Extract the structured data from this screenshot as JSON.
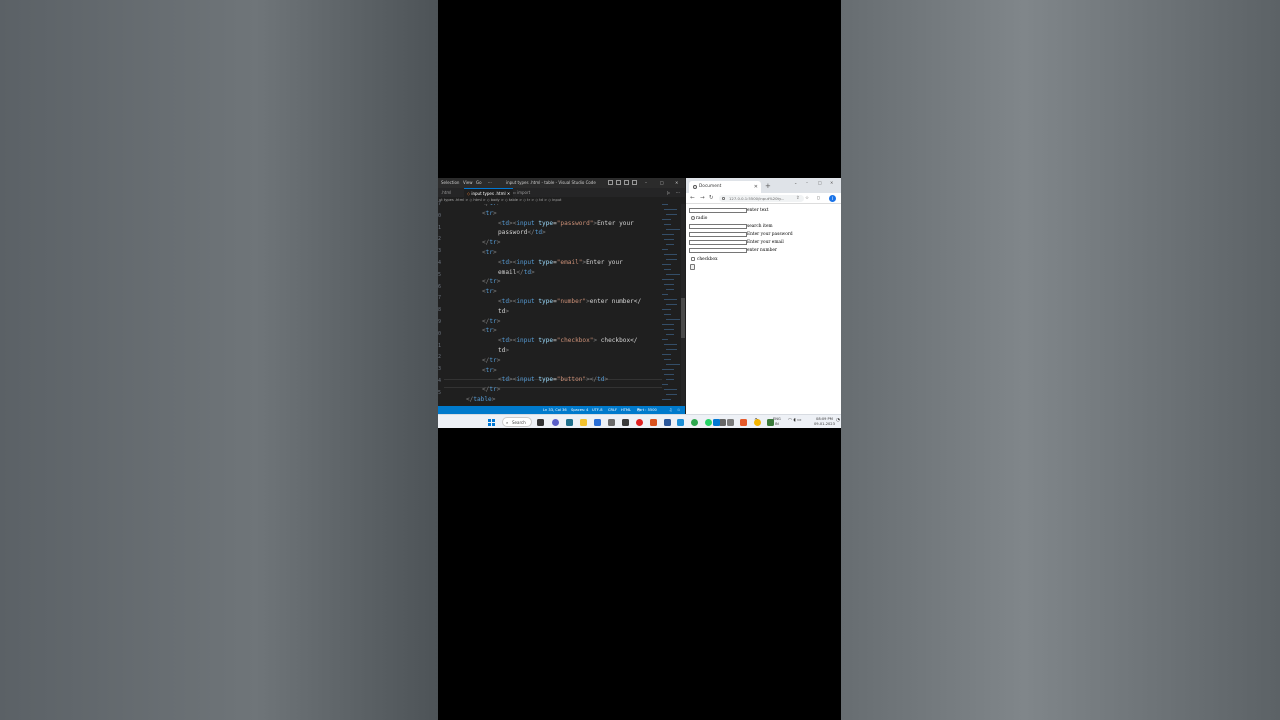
{
  "vscode": {
    "menu": [
      "Selection",
      "View",
      "Go",
      "···"
    ],
    "title": "input types .html - table - Visual Studio Code",
    "tabs": [
      ".html",
      "input types .html",
      "import"
    ],
    "breadcrumb": "ut types .html > ◇ html > ◇ body > ◇ table > ◇ tr > ◇ td > ◇ input",
    "gutter": [
      "7",
      "0",
      "1",
      "2",
      "3",
      "4",
      "5",
      "6",
      "7",
      "8",
      "9",
      "0",
      "1",
      "2",
      "3",
      "4",
      "5"
    ],
    "code_lines": [
      "</tr>",
      "<tr>",
      "<td><input type=\"password\">Enter your",
      "password</td>",
      "</tr>",
      "<tr>",
      "<td><input type=\"email\">Enter your",
      "email</td>",
      "</tr>",
      "<tr>",
      "<td><input type=\"number\">enter number</",
      "td>",
      "</tr>",
      "<tr>",
      "<td><input type=\"checkbox\"> checkbox</",
      "td>",
      "</tr>",
      "<tr>",
      "<td><input type=\"button\"></td>",
      "</tr>",
      "</table>"
    ],
    "status": {
      "position": "Ln 33, Col 36",
      "spaces": "Spaces: 4",
      "encoding": "UTF-8",
      "eol": "CRLF",
      "language": "HTML",
      "port": "Port : 5500"
    }
  },
  "browser": {
    "tab_title": "Document",
    "url": "127.0.0.1:5500/input%20ty...",
    "profile_initial": "I",
    "labels": {
      "text": "enter text",
      "radio": "radio",
      "search": "search item",
      "password": "Enter your password",
      "email": "Enter your email",
      "number": "enter number",
      "checkbox": "checkbox"
    }
  },
  "taskbar": {
    "search_label": "Search",
    "lang": "ENG",
    "lang_region": "IN",
    "time": "08:09 PM",
    "date": "09-01-2023"
  },
  "colors": {
    "vscode_bg": "#1f1f1f",
    "statusbar": "#007acc",
    "tag": "#569cd6",
    "attribute": "#9cdcfe",
    "string": "#ce9178",
    "taskbar_bg": "#eef1f6"
  }
}
